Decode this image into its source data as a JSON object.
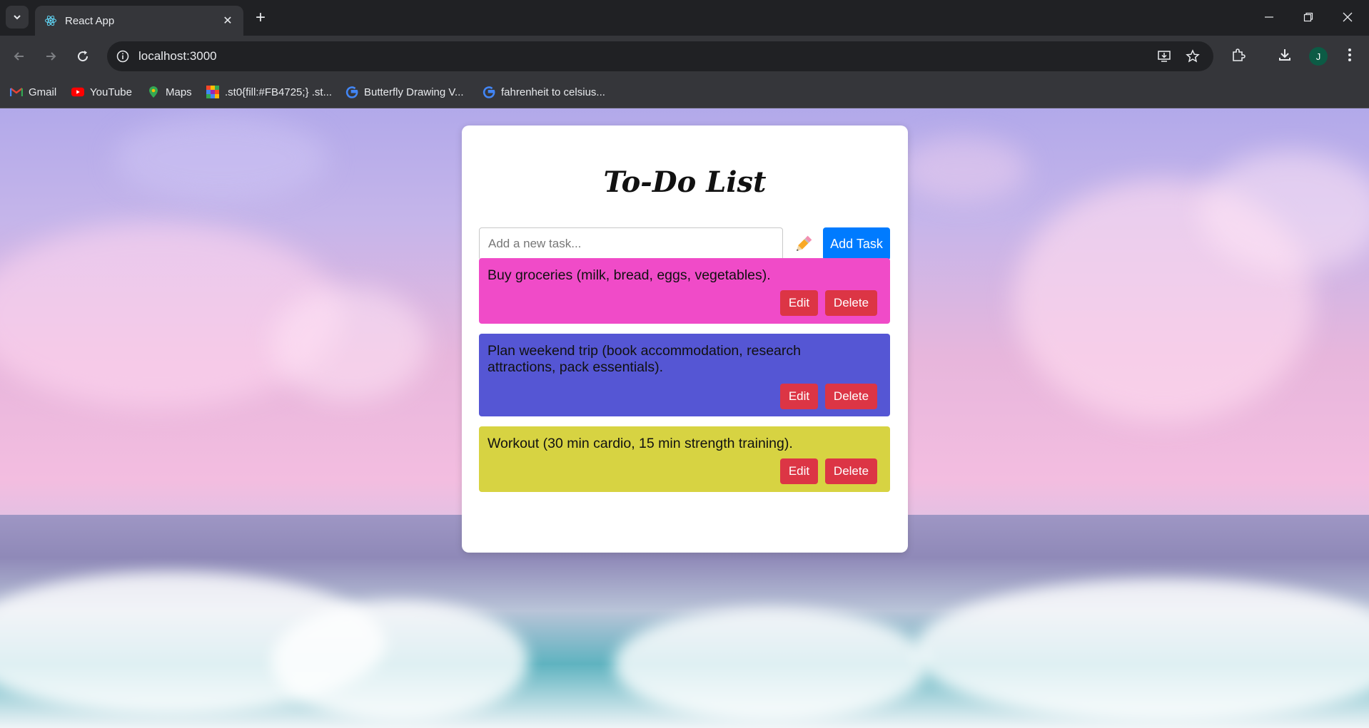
{
  "browser": {
    "tab": {
      "title": "React App",
      "favicon": "react-icon"
    },
    "new_tab_symbol": "+",
    "url": "localhost:3000",
    "profile_initial": "J",
    "bookmarks": [
      {
        "label": "Gmail",
        "icon": "gmail-icon"
      },
      {
        "label": "YouTube",
        "icon": "youtube-icon"
      },
      {
        "label": "Maps",
        "icon": "maps-icon"
      },
      {
        "label": ".st0{fill:#FB4725;} .st...",
        "icon": "colorful-grid-icon"
      },
      {
        "label": "Butterfly Drawing V...",
        "icon": "google-icon"
      },
      {
        "label": "fahrenheit to celsius...",
        "icon": "google-icon"
      }
    ]
  },
  "app": {
    "title": "To-Do List",
    "input_placeholder": "Add a new task...",
    "input_value": "",
    "add_label": "Add Task",
    "edit_label": "Edit",
    "delete_label": "Delete",
    "tasks": [
      {
        "text": "Buy groceries (milk, bread, eggs, vegetables).",
        "color": "#f04bc8"
      },
      {
        "text": "Plan weekend trip (book accommodation, research attractions, pack essentials).",
        "color": "#5556d4"
      },
      {
        "text": "Workout (30 min cardio, 15 min strength training).",
        "color": "#d7d342"
      }
    ]
  },
  "colors": {
    "primary": "#007bff",
    "danger": "#dc3545",
    "chrome_dark": "#202124",
    "chrome_mid": "#35363a"
  }
}
